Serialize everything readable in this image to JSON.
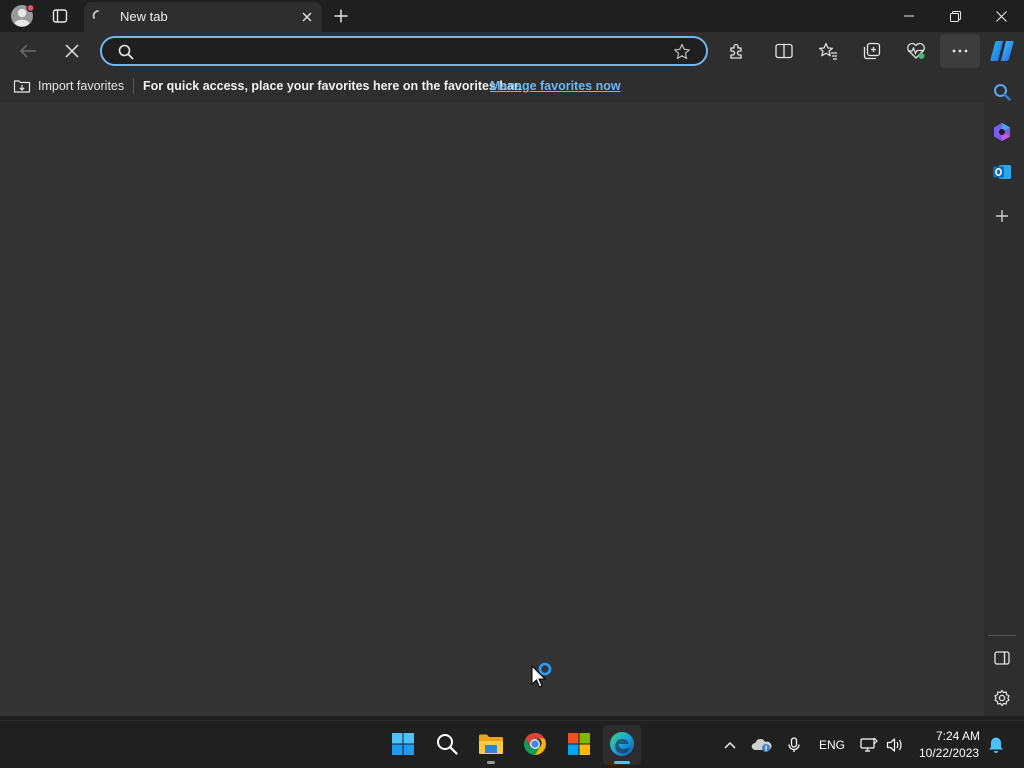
{
  "browser": {
    "tab_title": "New tab",
    "address_value": "",
    "address_placeholder": ""
  },
  "favorites_bar": {
    "import_label": "Import favorites",
    "message": "For quick access, place your favorites here on the favorites bar.",
    "manage_link": "Manage favorites now"
  },
  "taskbar": {
    "language": "ENG",
    "time": "7:24 AM",
    "date": "10/22/2023"
  },
  "colors": {
    "accent": "#6eb7f0",
    "frame": "#1f1f1f",
    "toolbar": "#2e2e2e",
    "content": "#343434",
    "taskbar": "#202020"
  },
  "icons": [
    "profile-avatar-icon",
    "tab-actions-icon",
    "tab-loading-icon",
    "tab-close-icon",
    "new-tab-icon",
    "minimize-icon",
    "restore-icon",
    "window-close-icon",
    "back-icon",
    "stop-icon",
    "search-icon",
    "favorite-star-icon",
    "extensions-icon",
    "split-screen-icon",
    "favorites-icon",
    "collections-icon",
    "browser-essentials-icon",
    "more-icon",
    "copilot-icon",
    "sidebar-search-icon",
    "sidebar-designer-icon",
    "sidebar-outlook-icon",
    "sidebar-add-icon",
    "sidebar-hide-icon",
    "sidebar-settings-icon",
    "start-icon",
    "taskbar-search-icon",
    "file-explorer-icon",
    "chrome-icon",
    "store-icon",
    "edge-icon",
    "tray-chevron-icon",
    "onedrive-icon",
    "microphone-icon",
    "network-icon",
    "volume-icon",
    "notifications-icon",
    "busy-cursor-icon"
  ]
}
